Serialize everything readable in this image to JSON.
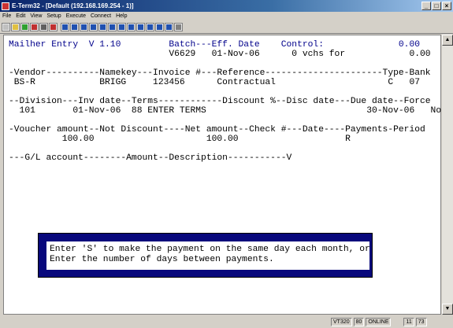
{
  "window": {
    "title": "E-Term32 - [Default (192.168.169.254 - 1)]"
  },
  "menu": [
    "File",
    "Edit",
    "View",
    "Setup",
    "Execute",
    "Connect",
    "Help"
  ],
  "toolbar_icons": [
    "new-icon",
    "open-icon",
    "connect-icon",
    "disconnect-icon",
    "print-icon",
    "stop-icon",
    "f1-icon",
    "f2-icon",
    "f3-icon",
    "f4-icon",
    "f5-icon",
    "f6-icon",
    "f7-icon",
    "f8-icon",
    "f9-icon",
    "f10-icon",
    "f11-icon",
    "f12-icon",
    "help-icon"
  ],
  "terminal": {
    "lines": [
      {
        "text": "Mailher Entry  V 1.10         Batch---Eff. Date    Control:              0.00",
        "blue": true
      },
      {
        "text": "                              V6629   01-Nov-06      0 vchs for            0.00"
      },
      {
        "text": ""
      },
      {
        "text": "-Vendor----------Namekey---Invoice #---Reference----------------------Type-Bank"
      },
      {
        "text": " BS-R            BRIGG     123456      Contractual                     C   07"
      },
      {
        "text": ""
      },
      {
        "text": "--Division---Inv date--Terms------------Discount %--Disc date---Due date--Force"
      },
      {
        "text": "  101       01-Nov-06  88 ENTER TERMS                              30-Nov-06   No"
      },
      {
        "text": ""
      },
      {
        "text": "-Voucher amount--Not Discount----Net amount--Check #---Date----Payments-Period"
      },
      {
        "text": "          100.00                     100.00                    R"
      },
      {
        "text": ""
      },
      {
        "text": "---G/L account--------Amount--Description-----------V"
      }
    ],
    "message": [
      "Enter 'S' to make the payment on the same day each month, or",
      "Enter the number of days between payments."
    ]
  },
  "status": {
    "terminal_type": "VT320",
    "columns": "80",
    "state": "ONLINE",
    "row": "11",
    "col": "73"
  }
}
